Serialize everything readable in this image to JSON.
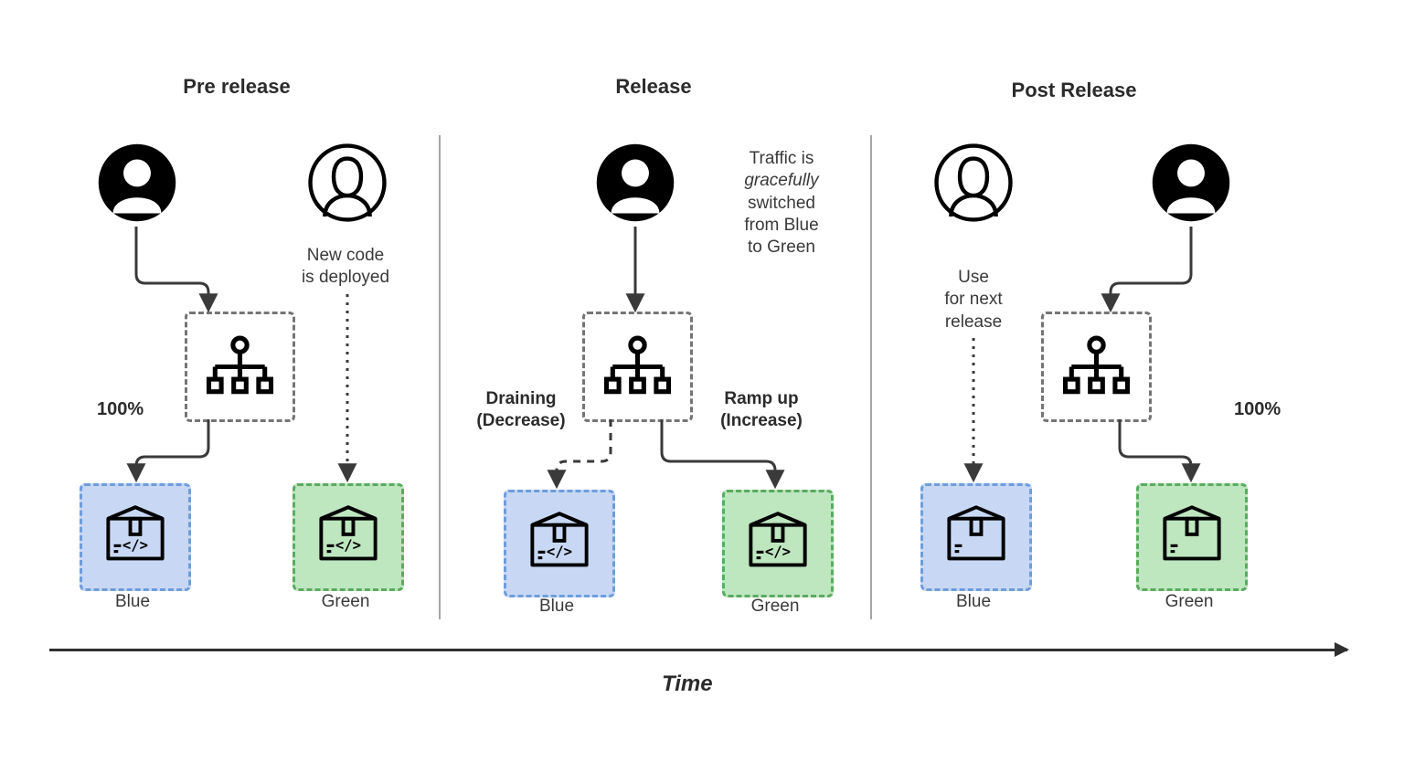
{
  "axis_label": "Time",
  "stages": {
    "pre": {
      "title": "Pre release",
      "blue_label": "Blue",
      "green_label": "Green",
      "pct": "100%",
      "note_line1": "New code",
      "note_line2": "is deployed"
    },
    "rel": {
      "title": "Release",
      "blue_label": "Blue",
      "green_label": "Green",
      "drain_line1": "Draining",
      "drain_line2": "(Decrease)",
      "ramp_line1": "Ramp up",
      "ramp_line2": "(Increase)",
      "traffic_l1": "Traffic is",
      "traffic_l2_italic": "gracefully",
      "traffic_l3": "switched",
      "traffic_l4": "from Blue",
      "traffic_l5": "to Green"
    },
    "post": {
      "title": "Post Release",
      "blue_label": "Blue",
      "green_label": "Green",
      "pct": "100%",
      "note_l1": "Use",
      "note_l2": "for next",
      "note_l3": "release"
    }
  },
  "colors": {
    "blue_bg": "#c8d8f4",
    "green_bg": "#bee6bf"
  }
}
